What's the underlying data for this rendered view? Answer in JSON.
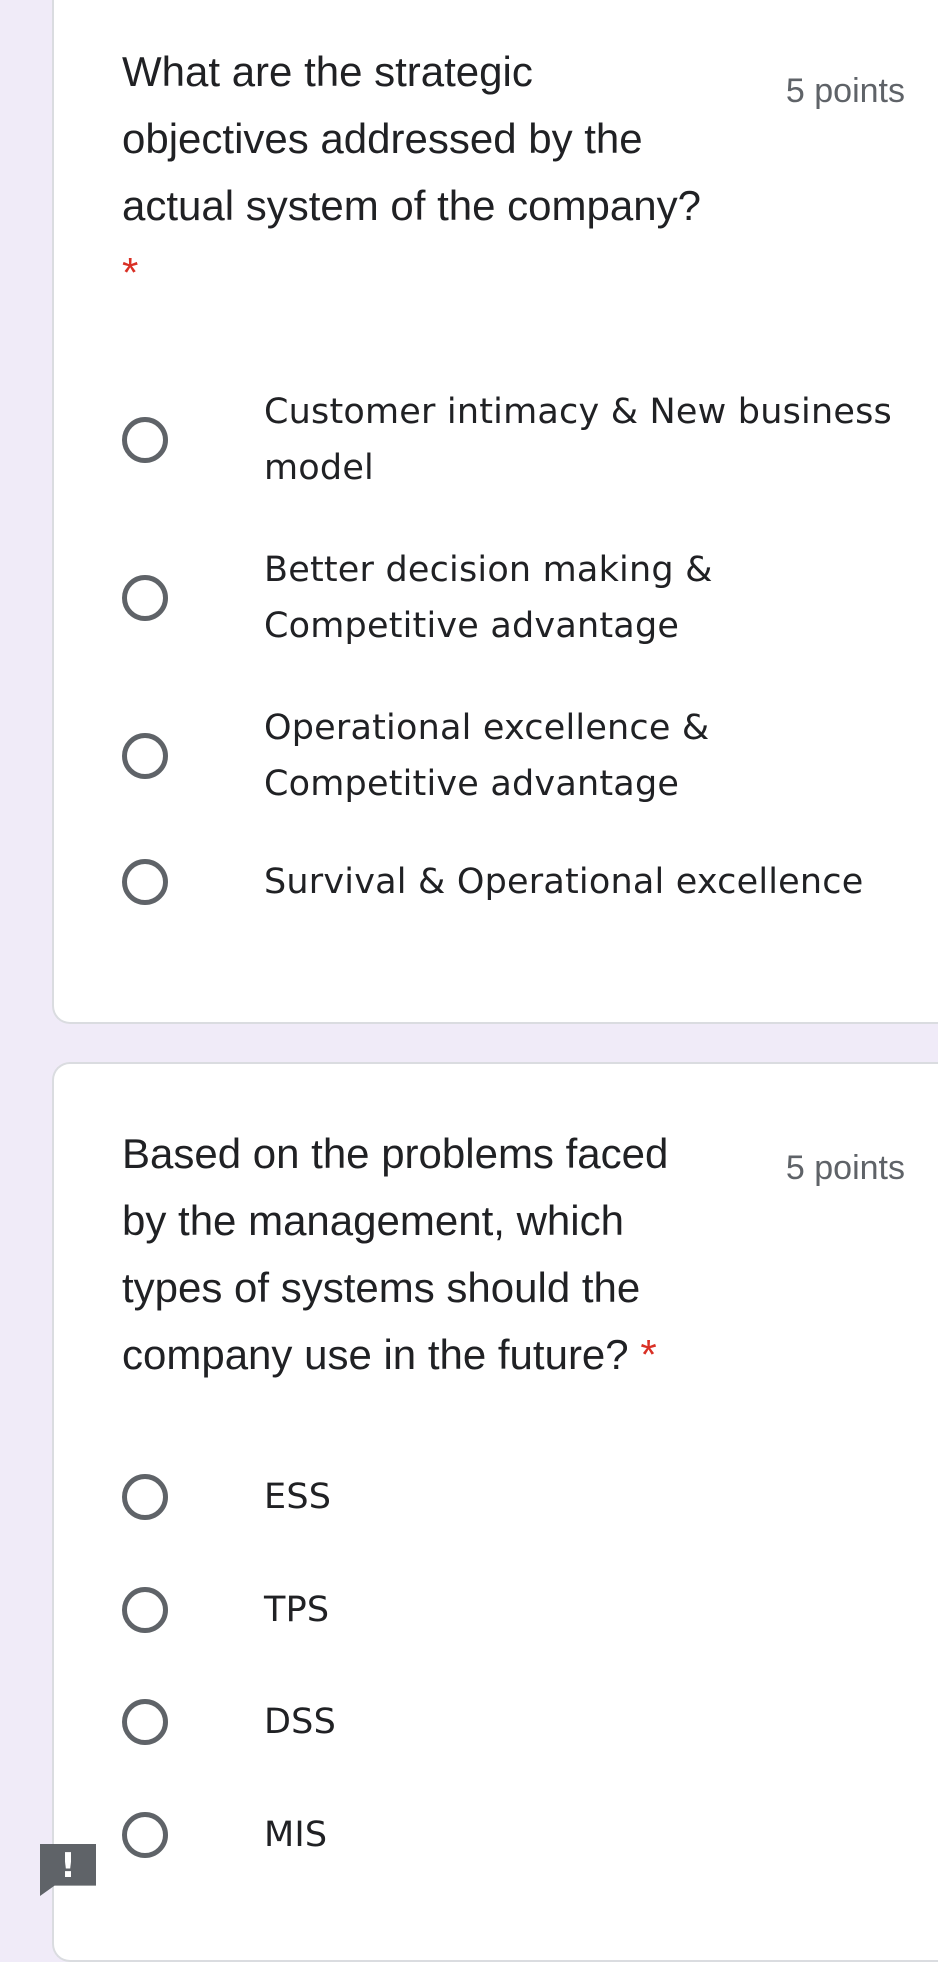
{
  "questions": [
    {
      "title": "What are the strategic objectives addressed by the actual system of the company?",
      "required_mark": "*",
      "points": "5 points",
      "options": [
        {
          "label": "Customer intimacy & New business model"
        },
        {
          "label": "Better decision making & Competitive advantage"
        },
        {
          "label": "Operational excellence & Competitive advantage"
        },
        {
          "label": "Survival & Operational excellence"
        }
      ]
    },
    {
      "title": "Based on the problems faced by the management, which types of systems should the company use in the future?",
      "required_mark": "*",
      "points": "5 points",
      "options": [
        {
          "label": "ESS"
        },
        {
          "label": "TPS"
        },
        {
          "label": "DSS"
        },
        {
          "label": "MIS"
        }
      ]
    }
  ],
  "feedback_icon": {
    "glyph": "!",
    "name": "report-problem-icon"
  },
  "colors": {
    "background": "#f0ebf8",
    "card": "#ffffff",
    "required": "#d93025",
    "radio": "#5f6368",
    "text": "#202124"
  }
}
